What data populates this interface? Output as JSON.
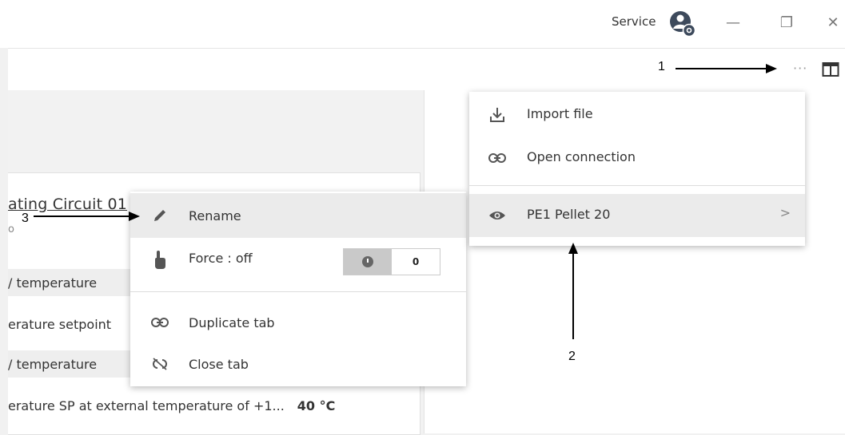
{
  "titlebar": {
    "account_label": "Service",
    "minimize_glyph": "—",
    "restore_glyph": "❐",
    "close_glyph": "✕"
  },
  "toolbar": {
    "more_glyph": "···"
  },
  "card": {
    "title": "ating Circuit 01",
    "subtitle": "o",
    "rows": [
      {
        "label": "/ temperature",
        "value": ""
      },
      {
        "label": "erature setpoint",
        "value": ""
      },
      {
        "label": "/ temperature",
        "value": ""
      },
      {
        "label": "erature SP at external temperature of +1...",
        "value": "40 °C"
      }
    ]
  },
  "context_menu": {
    "items": [
      {
        "label": "Rename",
        "icon": "pencil-icon"
      },
      {
        "label": "Force :  off",
        "icon": "hand-pointer-icon"
      },
      {
        "label": "Duplicate tab",
        "icon": "link-icon"
      },
      {
        "label": "Close tab",
        "icon": "unlink-icon"
      }
    ],
    "force_toggle": {
      "value": "0"
    }
  },
  "dropdown_menu": {
    "items": [
      {
        "label": "Import file",
        "icon": "download-icon"
      },
      {
        "label": "Open connection",
        "icon": "link-icon"
      },
      {
        "label": "PE1 Pellet 20",
        "icon": "eye-icon",
        "chevron": ">"
      }
    ]
  },
  "callouts": {
    "one": "1",
    "two": "2",
    "three": "3"
  }
}
